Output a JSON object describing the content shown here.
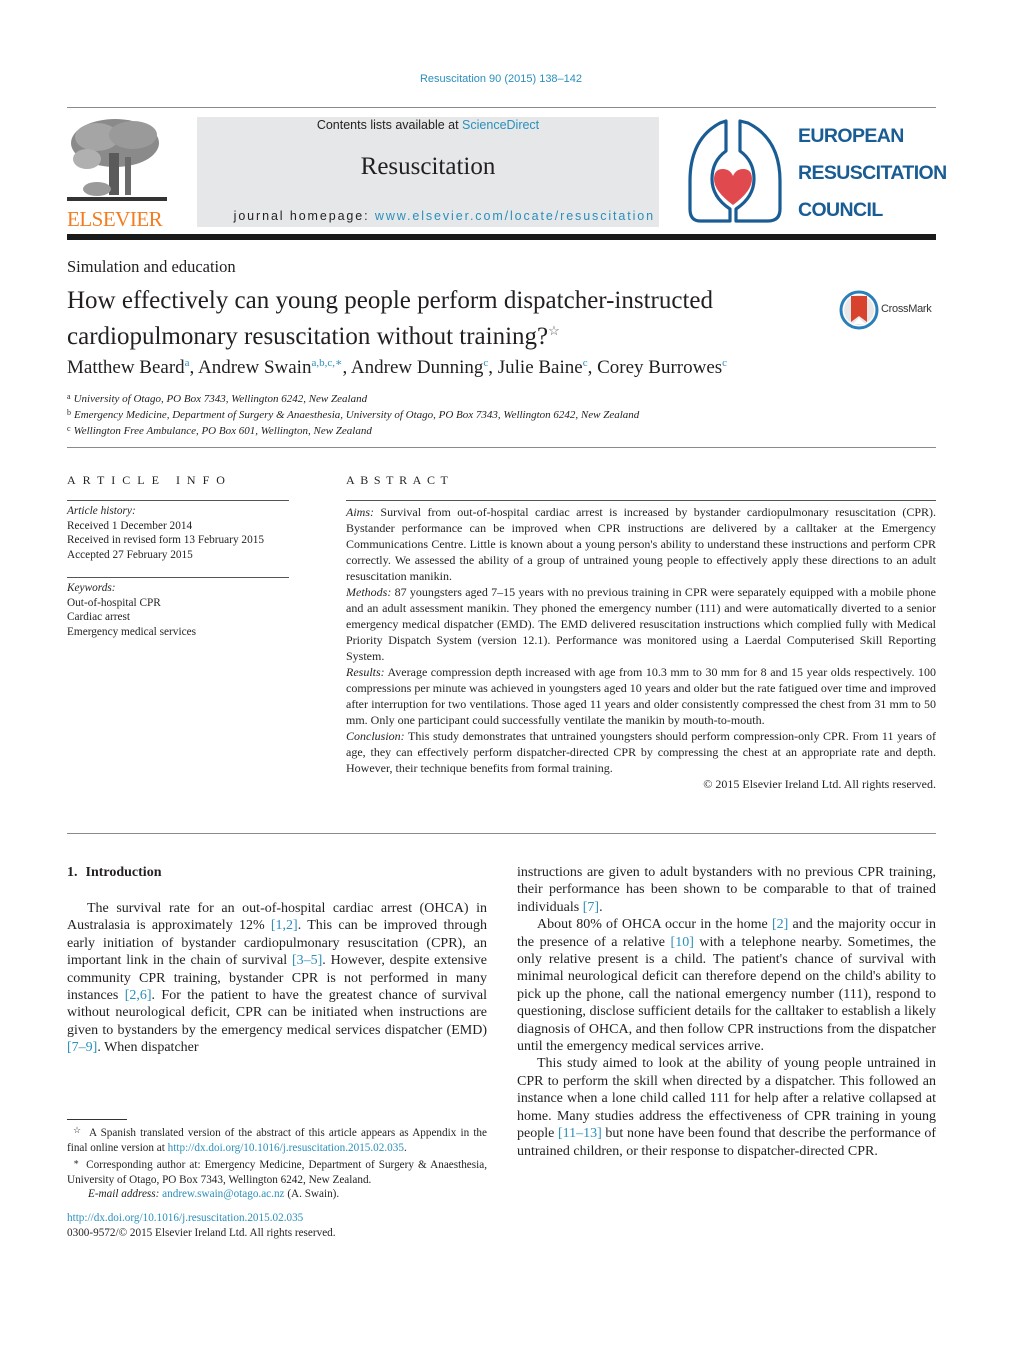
{
  "journal_ref": "Resuscitation 90 (2015) 138–142",
  "masthead": {
    "contents_prefix": "Contents lists available at ",
    "contents_link": "ScienceDirect",
    "journal_title": "Resuscitation",
    "homepage_prefix": "journal homepage: ",
    "homepage_link": "www.elsevier.com/locate/resuscitation"
  },
  "publisher_logo": {
    "icon": "elsevier-tree-logo",
    "word": "ELSEVIER",
    "color": "#f47c20"
  },
  "society_logo": {
    "icon": "lungs-heart-logo",
    "lines": [
      "EUROPEAN",
      "RESUSCITATION",
      "COUNCIL"
    ],
    "color": "#1a5c94",
    "heart_color": "#e04a4f"
  },
  "section_label": "Simulation and education",
  "article": {
    "title_line1": "How effectively can young people perform dispatcher-instructed",
    "title_line2": "cardiopulmonary resuscitation without training?",
    "title_mark": "☆",
    "crossmark_label": "CrossMark"
  },
  "authors": [
    {
      "name": "Matthew Beard",
      "sup": "a"
    },
    {
      "name": "Andrew Swain",
      "sup": "a,b,c,∗"
    },
    {
      "name": "Andrew Dunning",
      "sup": "c"
    },
    {
      "name": "Julie Baine",
      "sup": "c"
    },
    {
      "name": "Corey Burrowes",
      "sup": "c"
    }
  ],
  "affiliations": [
    {
      "mark": "a",
      "text": "University of Otago, PO Box 7343, Wellington 6242, New Zealand"
    },
    {
      "mark": "b",
      "text": "Emergency Medicine, Department of Surgery & Anaesthesia, University of Otago, PO Box 7343, Wellington 6242, New Zealand"
    },
    {
      "mark": "c",
      "text": "Wellington Free Ambulance, PO Box 601, Wellington, New Zealand"
    }
  ],
  "article_info": {
    "heading": "ARTICLE INFO",
    "history_label": "Article history:",
    "history": [
      "Received 1 December 2014",
      "Received in revised form 13 February 2015",
      "Accepted 27 February 2015"
    ],
    "keywords_label": "Keywords:",
    "keywords": [
      "Out-of-hospital CPR",
      "Cardiac arrest",
      "Emergency medical services"
    ]
  },
  "abstract": {
    "heading": "ABSTRACT",
    "sections": [
      {
        "label": "Aims:",
        "text": " Survival from out-of-hospital cardiac arrest is increased by bystander cardiopulmonary resuscitation (CPR). Bystander performance can be improved when CPR instructions are delivered by a calltaker at the Emergency Communications Centre. Little is known about a young person's ability to understand these instructions and perform CPR correctly. We assessed the ability of a group of untrained young people to effectively apply these directions to an adult resuscitation manikin."
      },
      {
        "label": "Methods:",
        "text": " 87 youngsters aged 7–15 years with no previous training in CPR were separately equipped with a mobile phone and an adult assessment manikin. They phoned the emergency number (111) and were automatically diverted to a senior emergency medical dispatcher (EMD). The EMD delivered resuscitation instructions which complied fully with Medical Priority Dispatch System (version 12.1). Performance was monitored using a Laerdal Computerised Skill Reporting System."
      },
      {
        "label": "Results:",
        "text": " Average compression depth increased with age from 10.3 mm to 30 mm for 8 and 15 year olds respectively. 100 compressions per minute was achieved in youngsters aged 10 years and older but the rate fatigued over time and improved after interruption for two ventilations. Those aged 11 years and older consistently compressed the chest from 31 mm to 50 mm. Only one participant could successfully ventilate the manikin by mouth-to-mouth."
      },
      {
        "label": "Conclusion:",
        "text": " This study demonstrates that untrained youngsters should perform compression-only CPR. From 11 years of age, they can effectively perform dispatcher-directed CPR by compressing the chest at an appropriate rate and depth. However, their technique benefits from formal training."
      }
    ],
    "copyright": "© 2015 Elsevier Ireland Ltd. All rights reserved."
  },
  "introduction": {
    "number": "1.",
    "heading": "Introduction",
    "p1": [
      {
        "t": "The survival rate for an out-of-hospital cardiac arrest (OHCA) in Australasia is approximately 12% "
      },
      {
        "ref": "[1,2]"
      },
      {
        "t": ". This can be improved through early initiation of bystander cardiopulmonary resuscitation (CPR), an important link in the chain of survival "
      },
      {
        "ref": "[3–5]"
      },
      {
        "t": ". However, despite extensive community CPR training, bystander CPR is not performed in many instances "
      },
      {
        "ref": "[2,6]"
      },
      {
        "t": ". For the patient to have the greatest chance of survival without neurological deficit, CPR can be initiated when instructions are given to bystanders by the emergency medical services dispatcher (EMD) "
      },
      {
        "ref": "[7–9]"
      },
      {
        "t": ". When dispatcher"
      }
    ],
    "p1_cont": [
      {
        "t": "instructions are given to adult bystanders with no previous CPR training, their performance has been shown to be comparable to that of trained individuals "
      },
      {
        "ref": "[7]"
      },
      {
        "t": "."
      }
    ],
    "p2": [
      {
        "t": "About 80% of OHCA occur in the home "
      },
      {
        "ref": "[2]"
      },
      {
        "t": " and the majority occur in the presence of a relative "
      },
      {
        "ref": "[10]"
      },
      {
        "t": " with a telephone nearby. Sometimes, the only relative present is a child. The patient's chance of survival with minimal neurological deficit can therefore depend on the child's ability to pick up the phone, call the national emergency number (111), respond to questioning, disclose sufficient details for the calltaker to establish a likely diagnosis of OHCA, and then follow CPR instructions from the dispatcher until the emergency medical services arrive."
      }
    ],
    "p3": [
      {
        "t": "This study aimed to look at the ability of young people untrained in CPR to perform the skill when directed by a dispatcher. This followed an instance when a lone child called 111 for help after a relative collapsed at home. Many studies address the effectiveness of CPR training in young people "
      },
      {
        "ref": "[11–13]"
      },
      {
        "t": " but none have been found that describe the performance of untrained children, or their response to dispatcher-directed CPR."
      }
    ]
  },
  "footnotes": {
    "star_mark": "☆",
    "star_text": " A Spanish translated version of the abstract of this article appears as Appendix in the final online version at ",
    "star_link": "http://dx.doi.org/10.1016/j.resuscitation.2015.02.035",
    "star_end": ".",
    "corr_mark": "∗",
    "corr_text": " Corresponding author at: Emergency Medicine, Department of Surgery & Anaesthesia, University of Otago, PO Box 7343, Wellington 6242, New Zealand.",
    "email_label": "E-mail address:",
    "email": "andrew.swain@otago.ac.nz",
    "email_suffix": " (A. Swain)."
  },
  "doi_footer": {
    "doi_link": "http://dx.doi.org/10.1016/j.resuscitation.2015.02.035",
    "issn_line": "0300-9572/© 2015 Elsevier Ireland Ltd. All rights reserved."
  }
}
